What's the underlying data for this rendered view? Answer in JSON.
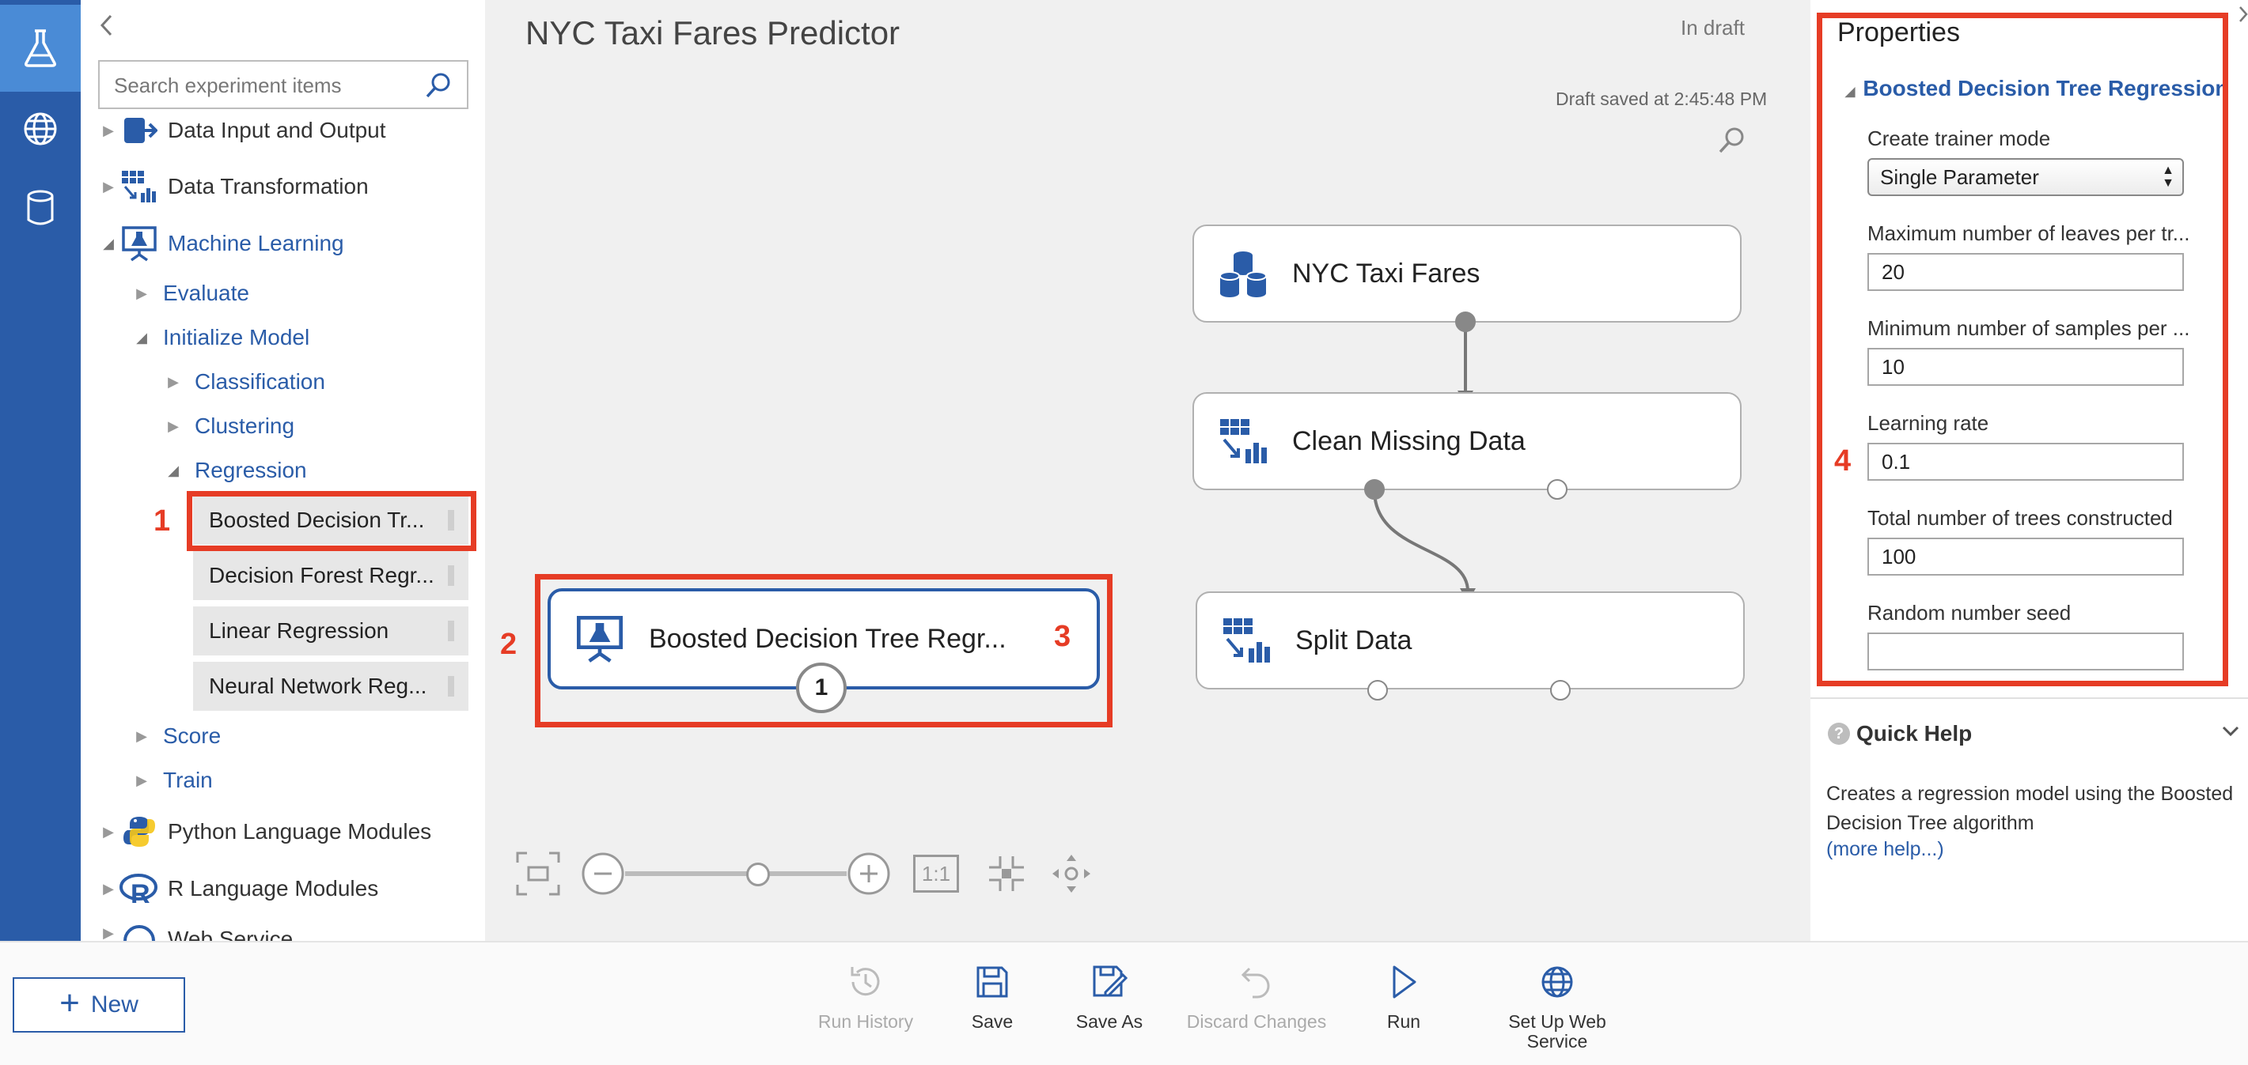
{
  "palette": {
    "search_placeholder": "Search experiment items",
    "categories": [
      {
        "label": "Data Input and Output"
      },
      {
        "label": "Data Transformation"
      },
      {
        "label": "Machine Learning"
      },
      {
        "label": "Evaluate"
      },
      {
        "label": "Initialize Model"
      },
      {
        "label": "Classification"
      },
      {
        "label": "Clustering"
      },
      {
        "label": "Regression"
      },
      {
        "label": "Score"
      },
      {
        "label": "Train"
      },
      {
        "label": "Python Language Modules"
      },
      {
        "label": "R Language Modules"
      },
      {
        "label": "Web Service"
      }
    ],
    "modules": [
      {
        "label": "Boosted Decision Tr..."
      },
      {
        "label": "Decision Forest Regr..."
      },
      {
        "label": "Linear Regression"
      },
      {
        "label": "Neural Network Reg..."
      }
    ]
  },
  "canvas": {
    "title": "NYC Taxi Fares Predictor",
    "status": "In draft",
    "saved": "Draft saved at 2:45:48 PM",
    "nodes": [
      {
        "label": "NYC Taxi Fares"
      },
      {
        "label": "Clean Missing Data"
      },
      {
        "label": "Split Data"
      },
      {
        "label": "Boosted Decision Tree Regr..."
      }
    ],
    "badge": "1",
    "zoom_fit_label": "1:1",
    "zoom_level": 0.6
  },
  "annotations": {
    "m1": "1",
    "m2": "2",
    "m3": "3",
    "m4": "4"
  },
  "properties": {
    "title": "Properties",
    "module_name": "Boosted Decision Tree Regression",
    "fields": [
      {
        "label": "Create trainer mode",
        "value": "Single Parameter"
      },
      {
        "label": "Maximum number of leaves per tr...",
        "value": "20"
      },
      {
        "label": "Minimum number of samples per ...",
        "value": "10"
      },
      {
        "label": "Learning rate",
        "value": "0.1"
      },
      {
        "label": "Total number of trees constructed",
        "value": "100"
      },
      {
        "label": "Random number seed",
        "value": ""
      }
    ]
  },
  "quick_help": {
    "title": "Quick Help",
    "text": "Creates a regression model using the Boosted Decision Tree algorithm",
    "link": "(more help...)"
  },
  "toolbar": {
    "new_label": "New",
    "run_history": "Run History",
    "save": "Save",
    "save_as": "Save As",
    "discard": "Discard Changes",
    "run": "Run",
    "web_service": "Set Up Web Service"
  },
  "colors": {
    "accent": "#2a5ca8",
    "highlight": "#e63c25",
    "rail": "#2a5ca8"
  }
}
